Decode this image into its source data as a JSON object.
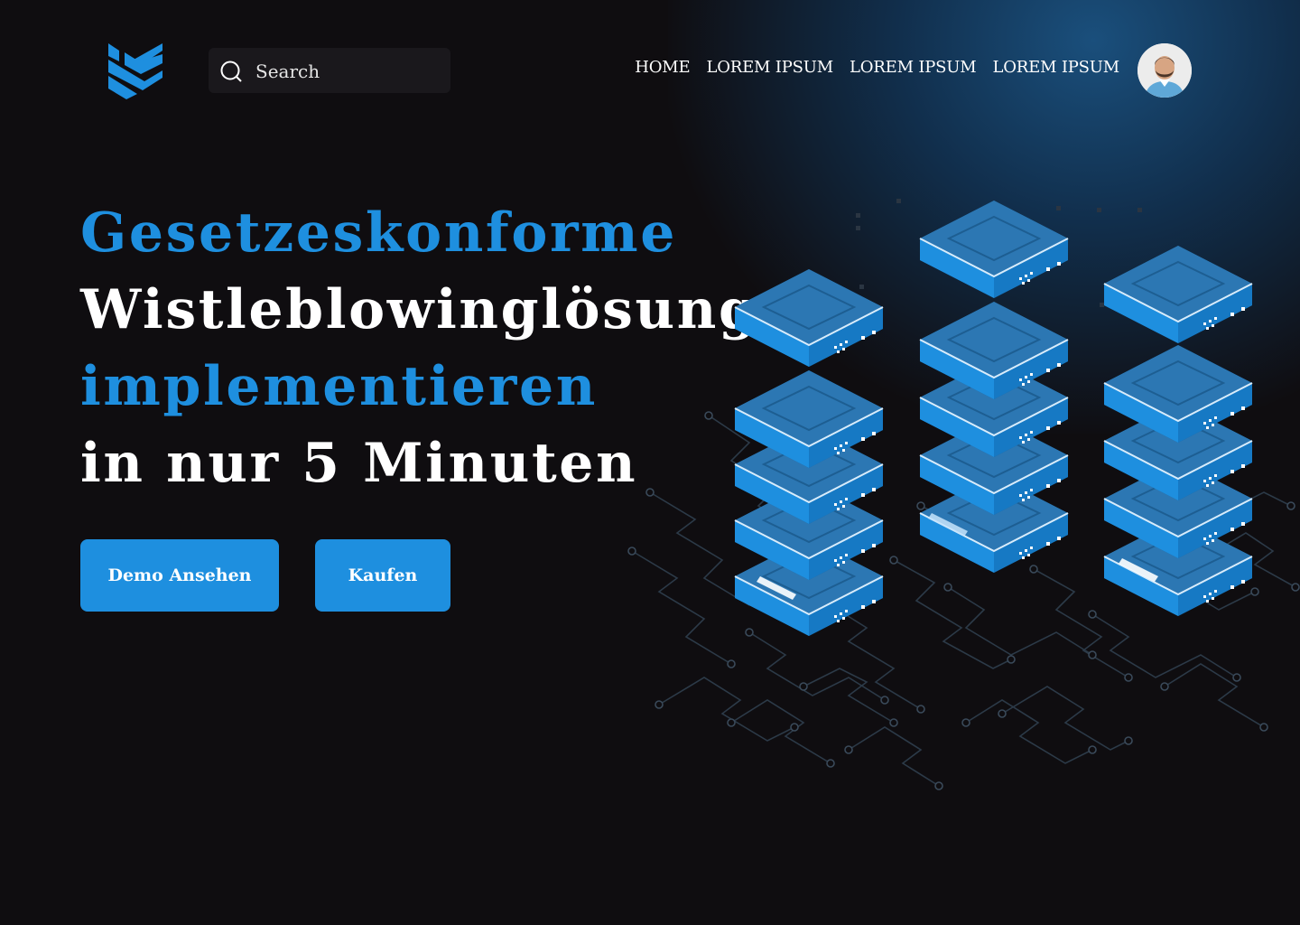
{
  "brand": {
    "logo_icon": "shield-logo-icon",
    "accent_color": "#1e8fdf"
  },
  "search": {
    "placeholder": "Search",
    "icon": "search-icon"
  },
  "nav": {
    "items": [
      {
        "label": "HOME"
      },
      {
        "label": "LOREM IPSUM"
      },
      {
        "label": "LOREM IPSUM"
      },
      {
        "label": "LOREM IPSUM"
      }
    ]
  },
  "user": {
    "avatar_icon": "user-avatar"
  },
  "hero": {
    "line1": "Gesetzeskonforme",
    "line2": "Wistleblowinglösung",
    "line3": "implementieren",
    "line4": "in nur 5 Minuten"
  },
  "actions": {
    "demo_label": "Demo Ansehen",
    "buy_label": "Kaufen"
  },
  "illustration": {
    "icon": "server-stack-illustration"
  }
}
